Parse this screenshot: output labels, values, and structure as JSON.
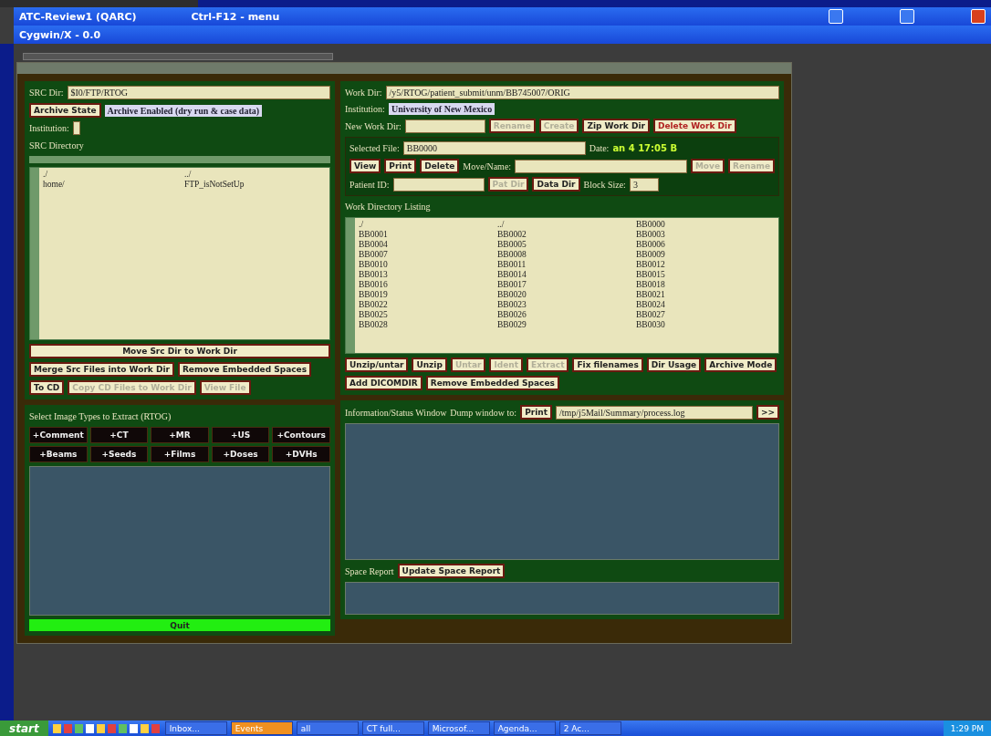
{
  "x_windows": [
    {
      "title": "ATC-Review1 (QARC)",
      "hint": "Ctrl-F12 - menu",
      "controls": true
    },
    {
      "title": "Cygwin/X - 0.0",
      "controls": false
    }
  ],
  "src": {
    "dir_label": "SRC Dir:",
    "dir": "$I0/FTP/RTOG",
    "archive_button": "Archive State",
    "archive_status": "Archive Enabled (dry run & case data)",
    "institution_label": "Institution:",
    "listing_title": "SRC Directory",
    "items": [
      "./",
      "../",
      "home/",
      "FTP_isNotSetUp"
    ],
    "move_button": "Move Src Dir to Work Dir",
    "buttons": [
      {
        "label": "Merge Src Files into Work Dir",
        "disabled": false
      },
      {
        "label": "Remove Embedded Spaces",
        "disabled": false
      }
    ],
    "cd_buttons": [
      {
        "label": "To CD",
        "disabled": false
      },
      {
        "label": "Copy CD Files to Work Dir",
        "disabled": true
      },
      {
        "label": "View File",
        "disabled": true
      }
    ]
  },
  "extract": {
    "title": "Select Image Types to Extract (RTOG)",
    "types": [
      "+Comment",
      "+CT",
      "+MR",
      "+US",
      "+Contours",
      "+Beams",
      "+Seeds",
      "+Films",
      "+Doses",
      "+DVHs"
    ],
    "quit": "Quit"
  },
  "work": {
    "dir_label": "Work Dir:",
    "dir": "/y5/RTOG/patient_submit/unm/BB745007/ORIG",
    "institution_label": "Institution:",
    "institution": "University of New Mexico",
    "new_dir_label": "New Work Dir:",
    "new_dir_buttons": [
      {
        "label": "Rename",
        "disabled": true,
        "danger": false
      },
      {
        "label": "Create",
        "disabled": true,
        "danger": false
      },
      {
        "label": "Zip Work Dir",
        "disabled": false,
        "danger": false
      },
      {
        "label": "Delete Work Dir",
        "disabled": false,
        "danger": true
      }
    ],
    "file_label": "Selected File:",
    "file": "BB0000",
    "date_label": "Date:",
    "date": "an 4 17:05 B",
    "file_buttons": [
      {
        "label": "View",
        "disabled": false
      },
      {
        "label": "Print",
        "disabled": false
      },
      {
        "label": "Delete",
        "disabled": false
      }
    ],
    "move_label": "Move/Name:",
    "move_buttons": [
      {
        "label": "Move",
        "disabled": true
      },
      {
        "label": "Rename",
        "disabled": true
      }
    ],
    "patient_label": "Patient ID:",
    "patient_buttons": [
      {
        "label": "Pat Dir",
        "disabled": true
      },
      {
        "label": "Data Dir",
        "disabled": false
      }
    ],
    "block_label": "Block Size:",
    "block": "3",
    "listing_title": "Work Directory Listing",
    "listing": [
      "./",
      "../",
      "BB0000",
      "BB0001",
      "BB0002",
      "BB0003",
      "BB0004",
      "BB0005",
      "BB0006",
      "BB0007",
      "BB0008",
      "BB0009",
      "BB0010",
      "BB0011",
      "BB0012",
      "BB0013",
      "BB0014",
      "BB0015",
      "BB0016",
      "BB0017",
      "BB0018",
      "BB0019",
      "BB0020",
      "BB0021",
      "BB0022",
      "BB0023",
      "BB0024",
      "BB0025",
      "BB0026",
      "BB0027",
      "BB0028",
      "BB0029",
      "BB0030"
    ],
    "actions": [
      {
        "label": "Unzip/untar",
        "disabled": false
      },
      {
        "label": "Unzip",
        "disabled": false
      },
      {
        "label": "Untar",
        "disabled": true
      },
      {
        "label": "Ident",
        "disabled": true
      },
      {
        "label": "Extract",
        "disabled": true
      },
      {
        "label": "Fix filenames",
        "disabled": false
      },
      {
        "label": "Dir Usage",
        "disabled": false
      },
      {
        "label": "Archive Mode",
        "disabled": false
      },
      {
        "label": "Add DICOMDIR",
        "disabled": false
      },
      {
        "label": "Remove Embedded Spaces",
        "disabled": false
      }
    ]
  },
  "status": {
    "title": "Information/Status Window",
    "dump_label": "Dump window to:",
    "print": "Print",
    "path": "/tmp/j5Mail/Summary/process.log",
    "more": ">>",
    "space_label": "Space Report",
    "space_button": "Update Space Report"
  },
  "taskbar": {
    "start": "start",
    "tasks": [
      {
        "label": "Inbox...",
        "selected": false
      },
      {
        "label": "Events",
        "selected": true
      },
      {
        "label": "all",
        "selected": false
      },
      {
        "label": "CT full...",
        "selected": false
      },
      {
        "label": "Microsof...",
        "selected": false
      },
      {
        "label": "Agenda...",
        "selected": false
      },
      {
        "label": "2 Ac...",
        "selected": false
      }
    ],
    "clock": "1:29 PM"
  }
}
